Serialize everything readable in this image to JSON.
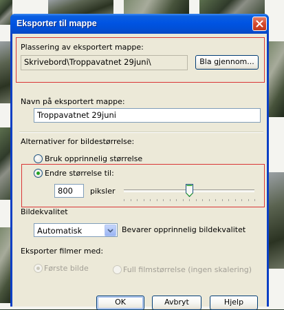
{
  "dialog": {
    "title": "Eksporter til mappe",
    "close_label": "×"
  },
  "location": {
    "label": "Plassering av eksportert mappe:",
    "path": "Skrivebord\\Troppavatnet 29juni\\",
    "browse_label": "Bla gjennom..."
  },
  "folder_name": {
    "label": "Navn på eksportert mappe:",
    "value": "Troppavatnet 29juni"
  },
  "image_size": {
    "label": "Alternativer for bildestørrelse:",
    "original_option": "Bruk opprinnelig størrelse",
    "resize_option": "Endre størrelse til:",
    "selected": "resize",
    "pixels_value": "800",
    "pixels_unit": "piksler",
    "slider_fraction": 0.5
  },
  "quality": {
    "label": "Bildekvalitet",
    "selected": "Automatisk",
    "description": "Bevarer opprinnelig bildekvalitet"
  },
  "video": {
    "label": "Eksporter filmer med:",
    "first_frame_option": "Første bilde",
    "full_size_option": "Full filmstørrelse (ingen skalering)",
    "selected": "first_frame",
    "enabled": false
  },
  "buttons": {
    "ok": "OK",
    "cancel": "Avbryt",
    "help": "Hjelp"
  },
  "colors": {
    "title_bar": "#0054e3",
    "highlight_box": "#d93434",
    "dialog_bg": "#ece9d8"
  }
}
